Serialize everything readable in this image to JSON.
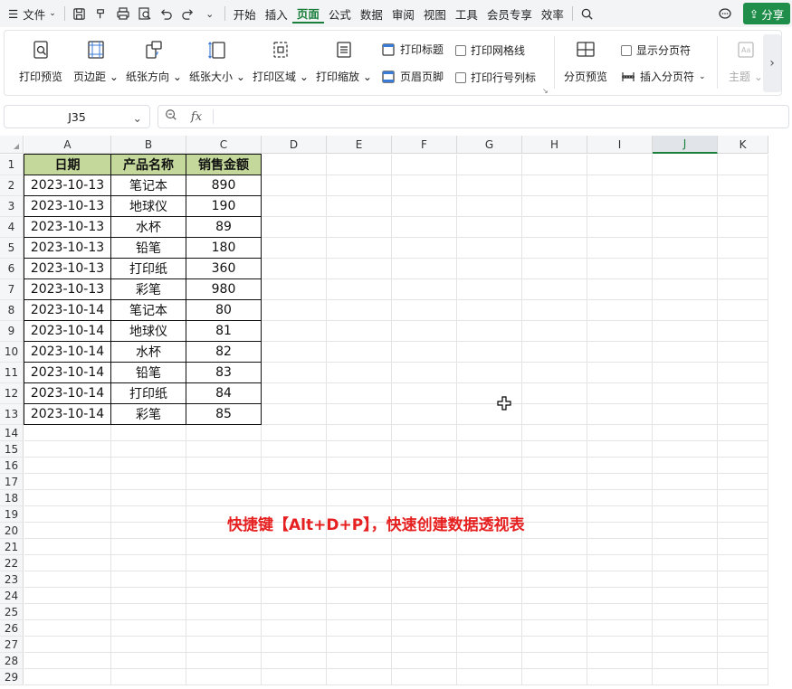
{
  "menubar": {
    "hamburger_label": "文件",
    "tabs": [
      "开始",
      "插入",
      "页面",
      "公式",
      "数据",
      "审阅",
      "视图",
      "工具",
      "会员专享",
      "效率"
    ],
    "active_tab": "页面",
    "share_label": "分享"
  },
  "ribbon": {
    "print_preview": "打印预览",
    "margins": "页边距",
    "orientation": "纸张方向",
    "paper_size": "纸张大小",
    "print_area": "打印区域",
    "print_scale": "打印缩放",
    "print_titles": "打印标题",
    "header_footer": "页眉页脚",
    "print_gridlines": "打印网格线",
    "print_row_col_headers": "打印行号列标",
    "page_break_preview": "分页预览",
    "show_page_breaks": "显示分页符",
    "insert_page_break": "插入分页符",
    "theme": "主题"
  },
  "formula_bar": {
    "name_box": "J35",
    "fx": "fx",
    "content": ""
  },
  "grid": {
    "columns": [
      "A",
      "B",
      "C",
      "D",
      "E",
      "F",
      "G",
      "H",
      "I",
      "J",
      "K"
    ],
    "selected_column": "J",
    "rows": [
      "1",
      "2",
      "3",
      "4",
      "5",
      "6",
      "7",
      "8",
      "9",
      "10",
      "11",
      "12",
      "13",
      "14",
      "15",
      "16",
      "17",
      "18",
      "19",
      "20",
      "21",
      "22",
      "23",
      "24",
      "25",
      "26",
      "27",
      "28",
      "29"
    ]
  },
  "table": {
    "headers": [
      "日期",
      "产品名称",
      "销售金额"
    ],
    "rows": [
      [
        "2023-10-13",
        "笔记本",
        "890"
      ],
      [
        "2023-10-13",
        "地球仪",
        "190"
      ],
      [
        "2023-10-13",
        "水杯",
        "89"
      ],
      [
        "2023-10-13",
        "铅笔",
        "180"
      ],
      [
        "2023-10-13",
        "打印纸",
        "360"
      ],
      [
        "2023-10-13",
        "彩笔",
        "980"
      ],
      [
        "2023-10-14",
        "笔记本",
        "80"
      ],
      [
        "2023-10-14",
        "地球仪",
        "81"
      ],
      [
        "2023-10-14",
        "水杯",
        "82"
      ],
      [
        "2023-10-14",
        "铅笔",
        "83"
      ],
      [
        "2023-10-14",
        "打印纸",
        "84"
      ],
      [
        "2023-10-14",
        "彩笔",
        "85"
      ]
    ]
  },
  "caption": "快捷键【Alt+D+P】，快速创建数据透视表",
  "colors": {
    "accent": "#1a7f3b",
    "header_fill": "#c4d89b",
    "caption": "#e62020",
    "share_button": "#1f8e4a"
  }
}
